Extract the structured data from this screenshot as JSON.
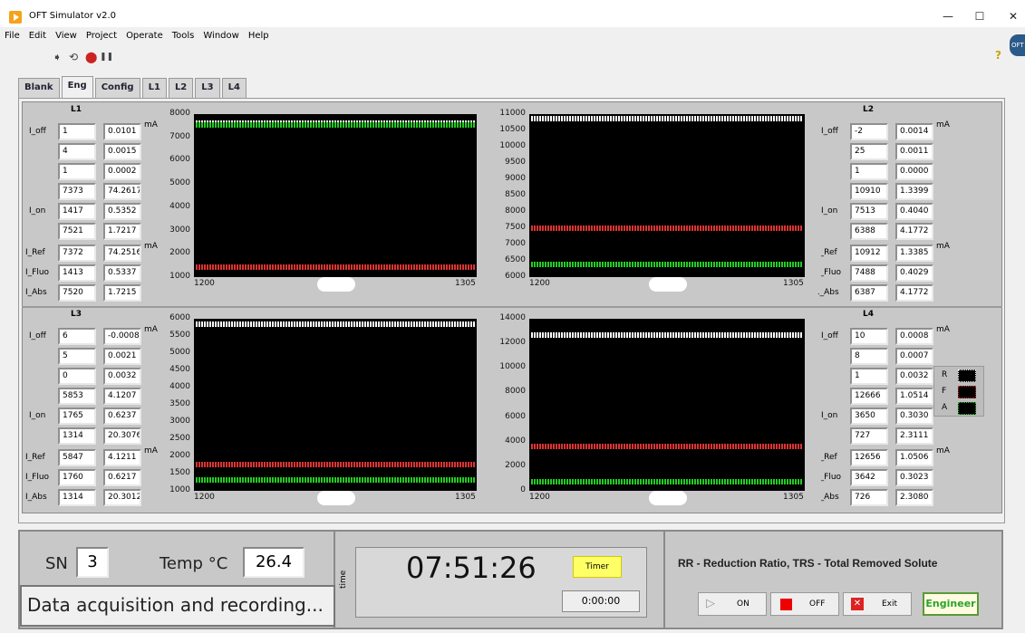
{
  "window": {
    "title": "OFT Simulator v2.0",
    "minimize": "—",
    "maximize": "☐",
    "close": "✕"
  },
  "menu": [
    "File",
    "Edit",
    "View",
    "Project",
    "Operate",
    "Tools",
    "Window",
    "Help"
  ],
  "toolbar": {
    "run": "➧",
    "run_continuous": "⟲",
    "abort": "⬤",
    "pause": "❚❚",
    "help": "?",
    "badge": "OFT"
  },
  "tabs": [
    "Blank",
    "Eng",
    "Config",
    "L1",
    "L2",
    "L3",
    "L4"
  ],
  "active_tab": "Eng",
  "unit": "mA",
  "row_labels": {
    "off": "I_off",
    "on": "I_on",
    "ref": "I_Ref",
    "fluo": "I_Fluo",
    "abs": "I_Abs"
  },
  "channels": {
    "L1": {
      "title": "L1",
      "off": [
        [
          "1",
          "0.0101"
        ],
        [
          "4",
          "0.0015"
        ],
        [
          "1",
          "0.0002"
        ]
      ],
      "on": [
        [
          "7373",
          "74.2617"
        ],
        [
          "1417",
          "0.5352"
        ],
        [
          "7521",
          "1.7217"
        ]
      ],
      "ref": [
        "7372",
        "74.2516"
      ],
      "fluo": [
        "1413",
        "0.5337"
      ],
      "abs": [
        "7520",
        "1.7215"
      ]
    },
    "L2": {
      "title": "L2",
      "off": [
        [
          "-2",
          "0.0014"
        ],
        [
          "25",
          "0.0011"
        ],
        [
          "1",
          "0.0000"
        ]
      ],
      "on": [
        [
          "10910",
          "1.3399"
        ],
        [
          "7513",
          "0.4040"
        ],
        [
          "6388",
          "4.1772"
        ]
      ],
      "ref": [
        "10912",
        "1.3385"
      ],
      "fluo": [
        "7488",
        "0.4029"
      ],
      "abs": [
        "6387",
        "4.1772"
      ]
    },
    "L3": {
      "title": "L3",
      "off": [
        [
          "6",
          "-0.0008"
        ],
        [
          "5",
          "0.0021"
        ],
        [
          "0",
          "0.0032"
        ]
      ],
      "on": [
        [
          "5853",
          "4.1207"
        ],
        [
          "1765",
          "0.6237"
        ],
        [
          "1314",
          "20.3076"
        ]
      ],
      "ref": [
        "5847",
        "4.1211"
      ],
      "fluo": [
        "1760",
        "0.6217"
      ],
      "abs": [
        "1314",
        "20.3012"
      ]
    },
    "L4": {
      "title": "L4",
      "off": [
        [
          "10",
          "0.0008"
        ],
        [
          "8",
          "0.0007"
        ],
        [
          "1",
          "0.0032"
        ]
      ],
      "on": [
        [
          "12666",
          "1.0514"
        ],
        [
          "3650",
          "0.3030"
        ],
        [
          "727",
          "2.3111"
        ]
      ],
      "ref": [
        "12656",
        "1.0506"
      ],
      "fluo": [
        "3642",
        "0.3023"
      ],
      "abs": [
        "726",
        "2.3080"
      ]
    }
  },
  "legend": {
    "r": "R",
    "f": "F",
    "a": "A"
  },
  "chart_data": [
    {
      "type": "line",
      "channel": "L1",
      "x": [
        1200,
        1305
      ],
      "xticks": [
        "1200",
        "1305"
      ],
      "yticks": [
        "8000",
        "7000",
        "6000",
        "5000",
        "4000",
        "3000",
        "2000",
        "1000"
      ],
      "ylim": [
        1000,
        8000
      ],
      "series": [
        {
          "color": "#ffffff",
          "values": [
            7600,
            7600
          ]
        },
        {
          "color": "#22cc22",
          "values": [
            7520,
            7520
          ]
        },
        {
          "color": "#dd3333",
          "values": [
            1413,
            1413
          ]
        }
      ]
    },
    {
      "type": "line",
      "channel": "L2",
      "x": [
        1200,
        1305
      ],
      "xticks": [
        "1200",
        "1305"
      ],
      "yticks": [
        "11000",
        "10500",
        "10000",
        "9500",
        "9000",
        "8500",
        "8000",
        "7500",
        "7000",
        "6500",
        "6000"
      ],
      "ylim": [
        6000,
        11000
      ],
      "series": [
        {
          "color": "#ffffff",
          "values": [
            10910,
            10910
          ]
        },
        {
          "color": "#dd3333",
          "values": [
            7490,
            7490
          ]
        },
        {
          "color": "#22cc22",
          "values": [
            6387,
            6387
          ]
        }
      ]
    },
    {
      "type": "line",
      "channel": "L3",
      "x": [
        1200,
        1305
      ],
      "xticks": [
        "1200",
        "1305"
      ],
      "yticks": [
        "6000",
        "5500",
        "5000",
        "4500",
        "4000",
        "3500",
        "3000",
        "2500",
        "2000",
        "1500",
        "1000"
      ],
      "ylim": [
        1000,
        6000
      ],
      "series": [
        {
          "color": "#ffffff",
          "values": [
            5850,
            5850
          ]
        },
        {
          "color": "#dd3333",
          "values": [
            1760,
            1760
          ]
        },
        {
          "color": "#22cc22",
          "values": [
            1314,
            1314
          ]
        }
      ]
    },
    {
      "type": "line",
      "channel": "L4",
      "x": [
        1200,
        1305
      ],
      "xticks": [
        "1200",
        "1305"
      ],
      "yticks": [
        "14000",
        "12000",
        "10000",
        "8000",
        "6000",
        "4000",
        "2000",
        "0"
      ],
      "ylim": [
        0,
        14000
      ],
      "series": [
        {
          "color": "#ffffff",
          "values": [
            12656,
            12656
          ]
        },
        {
          "color": "#dd3333",
          "values": [
            3642,
            3642
          ]
        },
        {
          "color": "#22cc22",
          "values": [
            726,
            726
          ]
        }
      ]
    }
  ],
  "bottom": {
    "sn_label": "SN",
    "sn_value": "3",
    "temp_label": "Temp °C",
    "temp_value": "26.4",
    "status": "Data acquisition and recording...",
    "time_label": "time",
    "clock": "07:51:26",
    "timer_btn": "Timer",
    "elapsed": "0:00:00",
    "info": "RR - Reduction Ratio, TRS - Total Removed Solute",
    "on_btn": "ON",
    "off_btn": "OFF",
    "exit_btn": "Exit",
    "engineer_btn": "Engineer"
  }
}
